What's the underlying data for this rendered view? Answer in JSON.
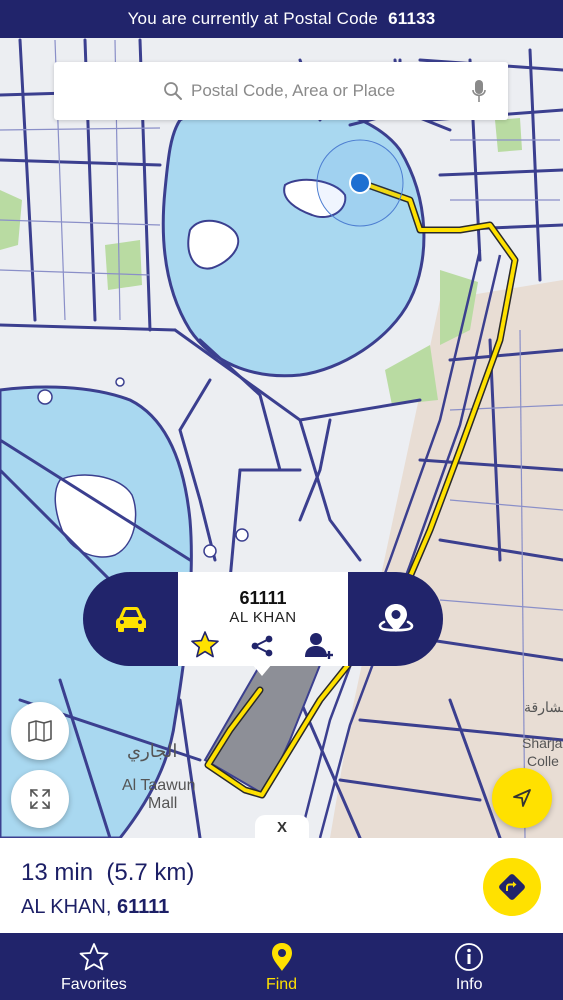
{
  "topbar": {
    "prefix": "You are currently at Postal Code",
    "code": "61133"
  },
  "search": {
    "placeholder": "Postal Code, Area or Place"
  },
  "card": {
    "postal_code": "61111",
    "area": "AL KHAN"
  },
  "map": {
    "labels": {
      "mall_line1": "Al Taawun",
      "mall_line2": "Mall",
      "arabic_mall": "الجاري",
      "college_line1": "Sharja",
      "college_line2": "Colle",
      "arabic_college": "الشارقة"
    },
    "close_label": "X"
  },
  "route": {
    "time": "13 min",
    "distance": "(5.7 km)",
    "area": "AL KHAN,",
    "code": "61111"
  },
  "nav": {
    "items": [
      {
        "label": "Favorites"
      },
      {
        "label": "Find"
      },
      {
        "label": "Info"
      }
    ]
  },
  "colors": {
    "brand_navy": "#21246b",
    "accent_yellow": "#ffe100",
    "water": "#a9d8f0",
    "park": "#b9dba2",
    "road": "#3b3f8f"
  }
}
